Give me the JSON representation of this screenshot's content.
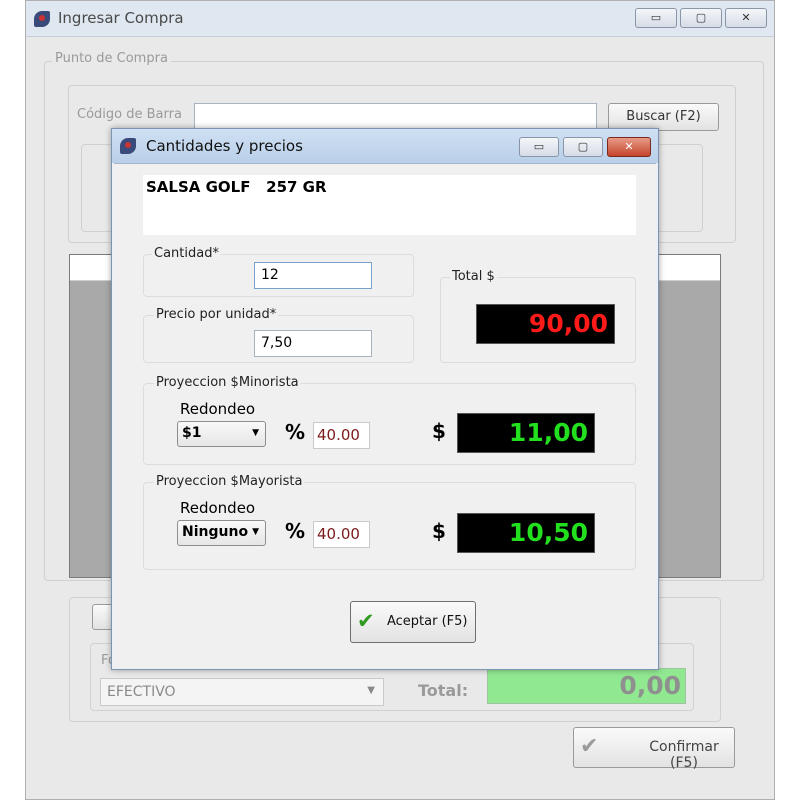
{
  "main_window": {
    "title": "Ingresar Compra",
    "buttons": {
      "minimize": "▭",
      "maximize": "▢",
      "close": "✕"
    },
    "punto_de_compra": {
      "legend": "Punto de Compra",
      "barcode_label": "Código de Barra",
      "barcode_value": "",
      "search_button": "Buscar (F2)"
    },
    "payment": {
      "legend_partial": "Fo",
      "method": "EFECTIVO",
      "total_label": "Total:",
      "total_value": "0,00"
    },
    "confirm_button": "Confirmar (F5)"
  },
  "dialog": {
    "title": "Cantidades y precios",
    "product_name": "SALSA GOLF   257 GR",
    "cantidad": {
      "label": "Cantidad*",
      "value": "12"
    },
    "precio_unidad": {
      "label": "Precio por unidad*",
      "value": "7,50"
    },
    "total": {
      "label": "Total $",
      "value": "90,00",
      "color": "#ff1a1a"
    },
    "minorista": {
      "legend": "Proyeccion $Minorista",
      "redondeo_label": "Redondeo",
      "redondeo_value": "$1",
      "percent_symbol": "%",
      "percent_value": "40.00",
      "currency_symbol": "$",
      "price": "11,00",
      "color": "#22e01e"
    },
    "mayorista": {
      "legend": "Proyeccion $Mayorista",
      "redondeo_label": "Redondeo",
      "redondeo_value": "Ninguno",
      "percent_symbol": "%",
      "percent_value": "40.00",
      "currency_symbol": "$",
      "price": "10,50",
      "color": "#22e01e"
    },
    "accept_button": "Aceptar (F5)"
  }
}
